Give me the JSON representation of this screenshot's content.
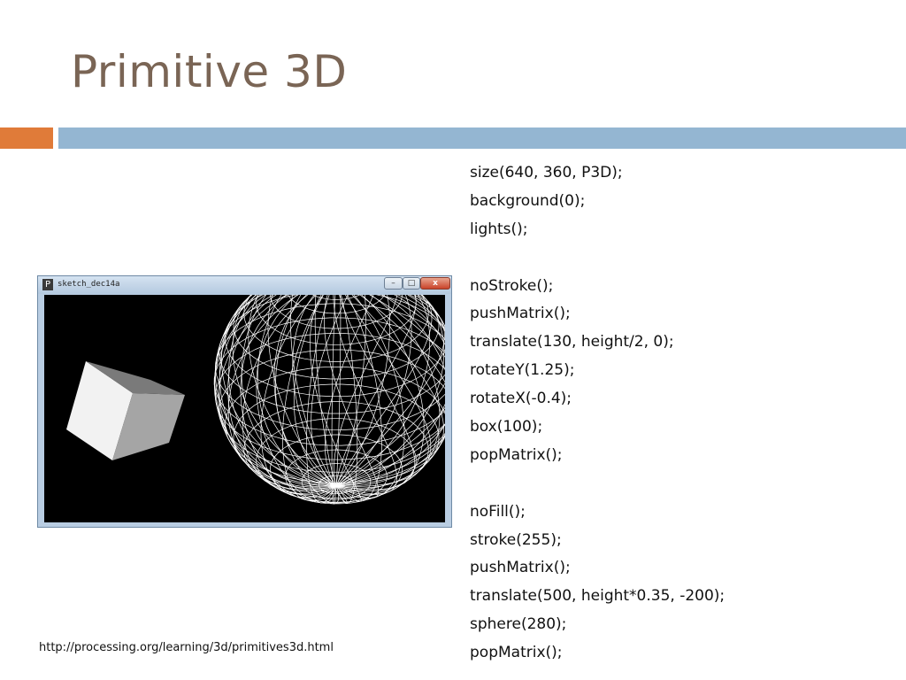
{
  "slide": {
    "title": "Primitive 3D",
    "credit": "http://processing.org/learning/3d/primitives3d.html"
  },
  "window": {
    "title": "sketch_dec14a",
    "app_icon": "P",
    "min_glyph": "–",
    "max_glyph": "□",
    "close_glyph": "x"
  },
  "code": [
    "size(640, 360, P3D);",
    "background(0);",
    "lights();",
    "",
    "noStroke();",
    "pushMatrix();",
    "translate(130, height/2, 0);",
    "rotateY(1.25);",
    "rotateX(-0.4);",
    "box(100);",
    "popMatrix();",
    "",
    "noFill();",
    "stroke(255);",
    "pushMatrix();",
    "translate(500, height*0.35, -200);",
    "sphere(280);",
    "popMatrix();"
  ],
  "colors": {
    "title": "#7a6555",
    "accent_orange": "#e07b39",
    "accent_blue": "#94b6d2"
  }
}
